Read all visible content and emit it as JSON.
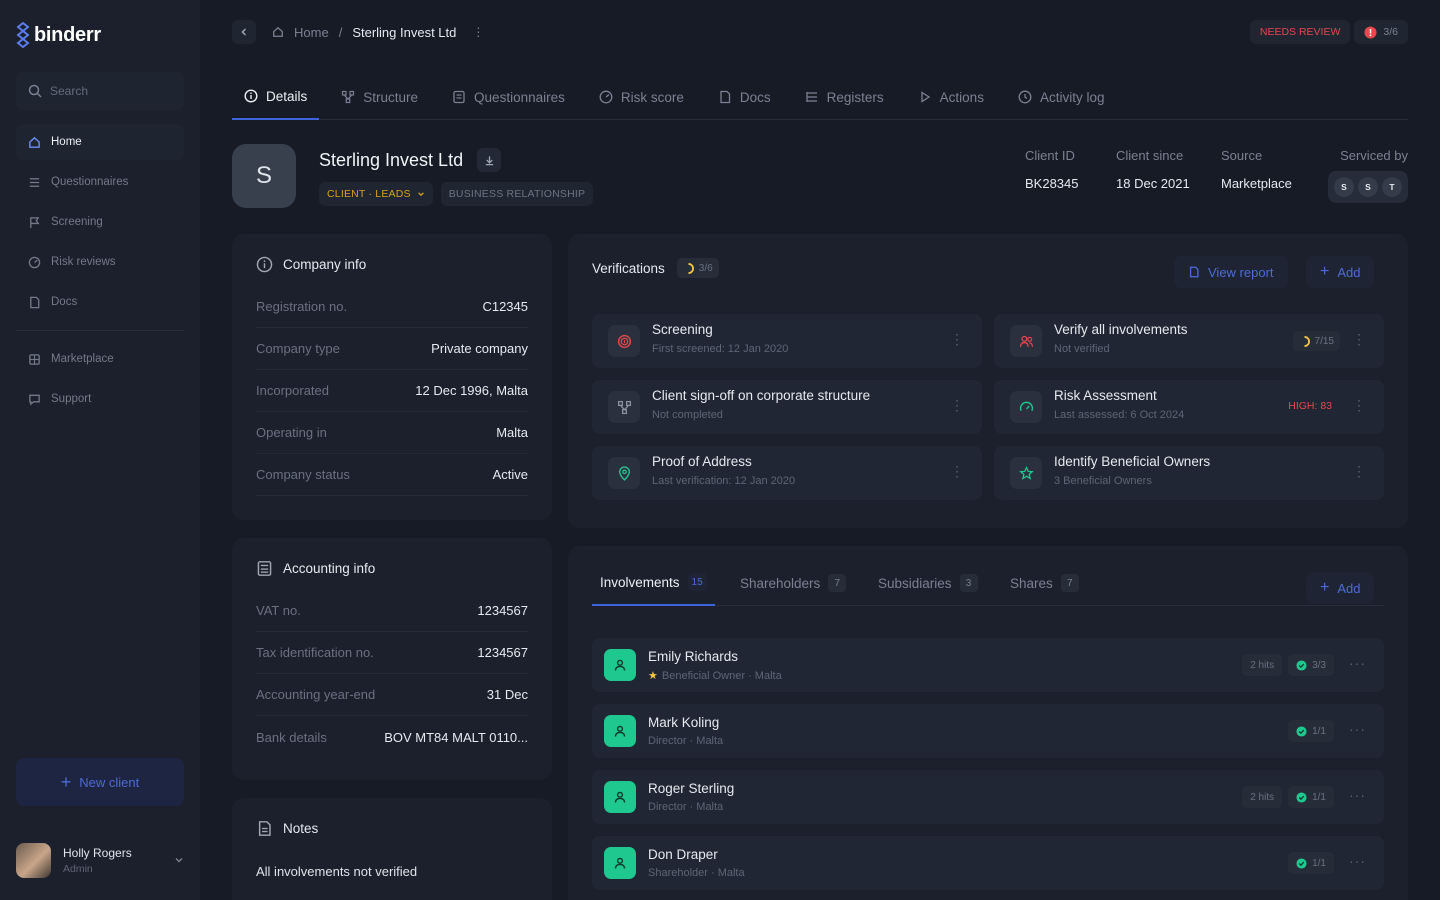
{
  "brand": {
    "name": "binderr",
    "accent": "#4d6bd6"
  },
  "search": {
    "placeholder": "Search"
  },
  "nav": {
    "primary": [
      {
        "label": "Home",
        "icon": "home-icon",
        "active": true
      },
      {
        "label": "Questionnaires",
        "icon": "list-icon"
      },
      {
        "label": "Screening",
        "icon": "flag-icon"
      },
      {
        "label": "Risk reviews",
        "icon": "gauge-icon"
      },
      {
        "label": "Docs",
        "icon": "document-icon"
      }
    ],
    "secondary": [
      {
        "label": "Marketplace",
        "icon": "grid-icon"
      },
      {
        "label": "Support",
        "icon": "chat-icon"
      }
    ],
    "new_client": "New client"
  },
  "user": {
    "name": "Holly Rogers",
    "role": "Admin"
  },
  "breadcrumb": {
    "home": "Home",
    "current": "Sterling Invest Ltd"
  },
  "review": {
    "label": "NEEDS REVIEW",
    "progress": "3/6"
  },
  "tabs": [
    {
      "label": "Details",
      "icon": "info-icon",
      "active": true
    },
    {
      "label": "Structure",
      "icon": "structure-icon"
    },
    {
      "label": "Questionnaires",
      "icon": "form-icon"
    },
    {
      "label": "Risk score",
      "icon": "gauge-icon"
    },
    {
      "label": "Docs",
      "icon": "document-icon"
    },
    {
      "label": "Registers",
      "icon": "list-icon"
    },
    {
      "label": "Actions",
      "icon": "play-icon"
    },
    {
      "label": "Activity log",
      "icon": "clock-icon"
    }
  ],
  "client": {
    "initial": "S",
    "name": "Sterling Invest Ltd",
    "tag_primary": "CLIENT · LEADS",
    "tag_secondary": "BUSINESS RELATIONSHIP",
    "meta": [
      {
        "label": "Client ID",
        "value": "BK28345"
      },
      {
        "label": "Client since",
        "value": "18 Dec 2021"
      },
      {
        "label": "Source",
        "value": "Marketplace"
      }
    ],
    "serviced_label": "Serviced by",
    "serviced_by": [
      "S",
      "S",
      "T"
    ]
  },
  "company_info": {
    "title": "Company info",
    "rows": [
      {
        "label": "Registration no.",
        "value": "C12345"
      },
      {
        "label": "Company type",
        "value": "Private company"
      },
      {
        "label": "Incorporated",
        "value": "12 Dec 1996, Malta"
      },
      {
        "label": "Operating in",
        "value": "Malta"
      },
      {
        "label": "Company status",
        "value": "Active"
      }
    ]
  },
  "accounting_info": {
    "title": "Accounting info",
    "rows": [
      {
        "label": "VAT no.",
        "value": "1234567"
      },
      {
        "label": "Tax identification no.",
        "value": "1234567"
      },
      {
        "label": "Accounting year-end",
        "value": "31 Dec"
      },
      {
        "label": "Bank details",
        "value": "BOV MT84 MALT 0110..."
      }
    ]
  },
  "notes": {
    "title": "Notes",
    "text": "All involvements not verified"
  },
  "verifications": {
    "title": "Verifications",
    "count": "3/6",
    "view_report": "View report",
    "add": "Add",
    "items": [
      {
        "title": "Screening",
        "subtitle": "First screened: 12 Jan 2020",
        "icon": "fingerprint-icon",
        "icon_color": "#e5484d",
        "badge": ""
      },
      {
        "title": "Verify all involvements",
        "subtitle": "Not verified",
        "icon": "users-icon",
        "icon_color": "#e5484d",
        "badge": "7/15"
      },
      {
        "title": "Client sign-off on corporate structure",
        "subtitle": "Not completed",
        "icon": "structure-icon",
        "icon_color": "#8a91a0",
        "badge": ""
      },
      {
        "title": "Risk Assessment",
        "subtitle": "Last assessed: 6 Oct 2024",
        "icon": "gauge-icon",
        "icon_color": "#1ec88f",
        "badge": "HIGH: 83"
      },
      {
        "title": "Proof of Address",
        "subtitle": "Last verification: 12 Jan 2020",
        "icon": "location-icon",
        "icon_color": "#1ec88f",
        "badge": ""
      },
      {
        "title": "Identify Beneficial Owners",
        "subtitle": "3 Beneficial Owners",
        "icon": "star-icon",
        "icon_color": "#1ec88f",
        "badge": ""
      }
    ]
  },
  "involvements": {
    "tabs": [
      {
        "label": "Involvements",
        "count": "15",
        "active": true
      },
      {
        "label": "Shareholders",
        "count": "7"
      },
      {
        "label": "Subsidiaries",
        "count": "3"
      },
      {
        "label": "Shares",
        "count": "7"
      }
    ],
    "add": "Add",
    "rows": [
      {
        "name": "Emily Richards",
        "role": "Beneficial Owner · Malta",
        "starred": true,
        "hits": "2 hits",
        "verified": "3/3"
      },
      {
        "name": "Mark Koling",
        "role": "Director · Malta",
        "starred": false,
        "hits": "",
        "verified": "1/1"
      },
      {
        "name": "Roger Sterling",
        "role": "Director · Malta",
        "starred": false,
        "hits": "2 hits",
        "verified": "1/1"
      },
      {
        "name": "Don Draper",
        "role": "Shareholder · Malta",
        "starred": false,
        "hits": "",
        "verified": "1/1"
      }
    ]
  }
}
